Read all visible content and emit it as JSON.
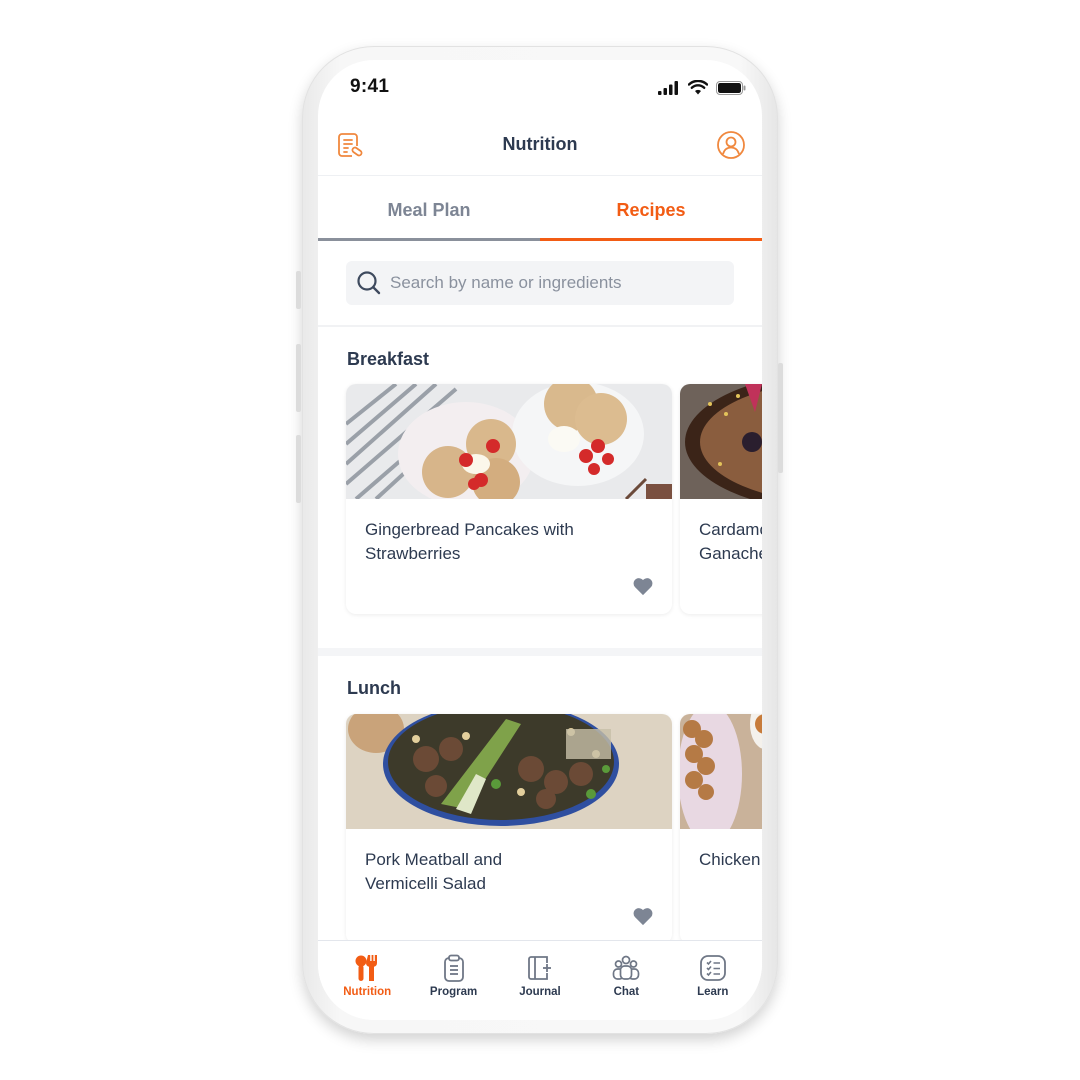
{
  "status_bar": {
    "time": "9:41"
  },
  "header": {
    "title": "Nutrition",
    "left_icon": "recipe-notes-icon",
    "right_icon": "profile-icon"
  },
  "tabs": [
    {
      "label": "Meal Plan",
      "active": false
    },
    {
      "label": "Recipes",
      "active": true
    }
  ],
  "search": {
    "placeholder": "Search by name or ingredients",
    "value": ""
  },
  "sections": [
    {
      "title": "Breakfast",
      "recipes": [
        {
          "name": "Gingerbread Pancakes with Strawberries",
          "favorite_icon": "heart-icon"
        },
        {
          "name": "Cardamom Ganache",
          "favorite_icon": "heart-icon"
        }
      ]
    },
    {
      "title": "Lunch",
      "recipes": [
        {
          "name": "Pork Meatball and Vermicelli Salad",
          "favorite_icon": "heart-icon"
        },
        {
          "name": "Chicken",
          "favorite_icon": "heart-icon"
        }
      ]
    }
  ],
  "bottom_nav": [
    {
      "label": "Nutrition",
      "icon": "utensils-icon",
      "active": true
    },
    {
      "label": "Program",
      "icon": "clipboard-icon",
      "active": false
    },
    {
      "label": "Journal",
      "icon": "journal-add-icon",
      "active": false
    },
    {
      "label": "Chat",
      "icon": "group-icon",
      "active": false
    },
    {
      "label": "Learn",
      "icon": "checklist-icon",
      "active": false
    }
  ],
  "colors": {
    "accent": "#f25c14",
    "icon_orange": "#f0883e",
    "text_dark": "#2d3a50",
    "text_muted": "#7d8594",
    "heart_gray": "#7d8594"
  }
}
